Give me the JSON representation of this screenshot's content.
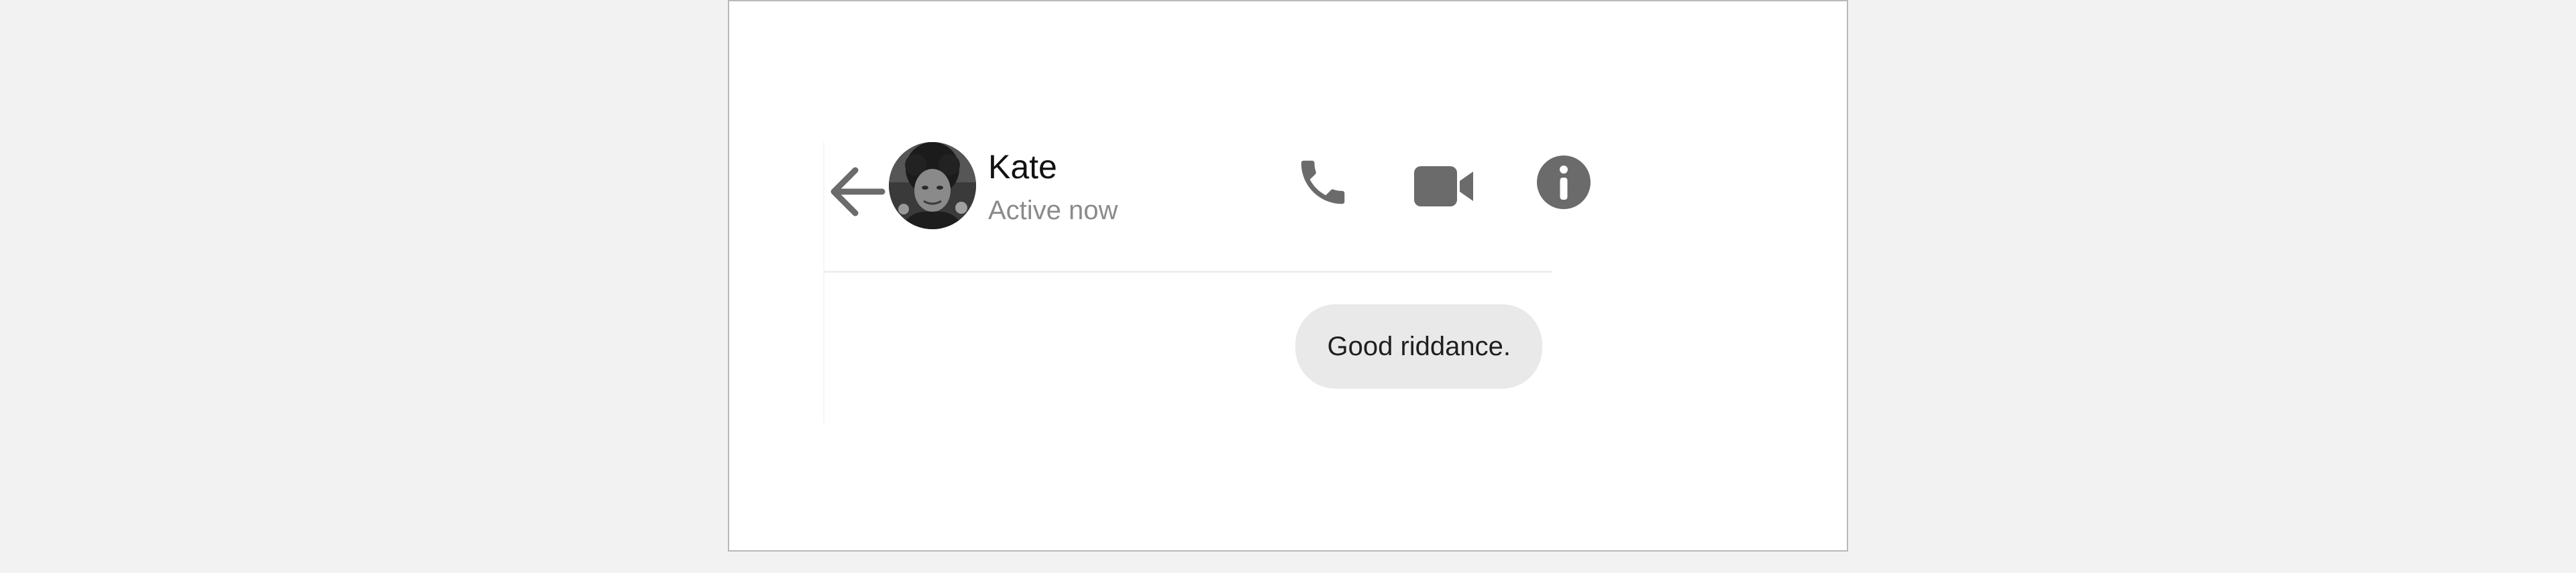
{
  "header": {
    "contact_name": "Kate",
    "contact_status": "Active now"
  },
  "icons": {
    "back": "back-arrow-icon",
    "call": "phone-icon",
    "video": "video-camera-icon",
    "info": "info-icon"
  },
  "colors": {
    "icon": "#6b6b6b",
    "bubble_bg": "#e9e9e9",
    "status_text": "#8b8b8b"
  },
  "messages": [
    {
      "direction": "outgoing",
      "text": "Good riddance."
    }
  ]
}
